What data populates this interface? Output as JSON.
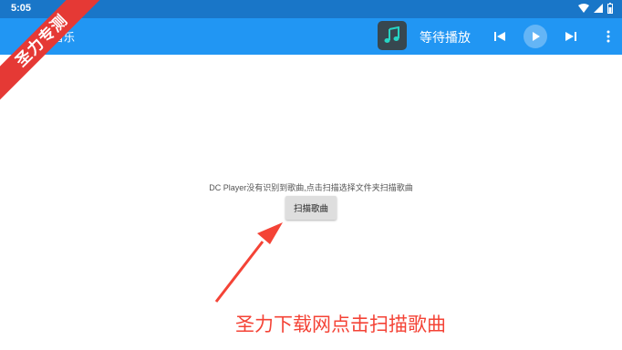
{
  "status_bar": {
    "time": "5:05",
    "icons": [
      "wifi-icon",
      "signal-icon",
      "battery-icon"
    ]
  },
  "app_bar": {
    "title": "音乐",
    "now_playing": "等待播放",
    "icons": [
      "album-art-icon",
      "previous-icon",
      "play-icon",
      "next-icon",
      "more-icon"
    ]
  },
  "main": {
    "empty_message": "DC Player没有识别到歌曲,点击扫描选择文件夹扫描歌曲",
    "scan_button": "扫描歌曲"
  },
  "overlay": {
    "ribbon_text": "圣力专测",
    "caption": "圣力下载网点击扫描歌曲"
  },
  "colors": {
    "status_bar": "#1976c8",
    "app_bar": "#2196f3",
    "play_button": "#64b5f6",
    "album_art": "#37474f",
    "album_note": "#26d4c4",
    "annotation": "#f44336"
  }
}
